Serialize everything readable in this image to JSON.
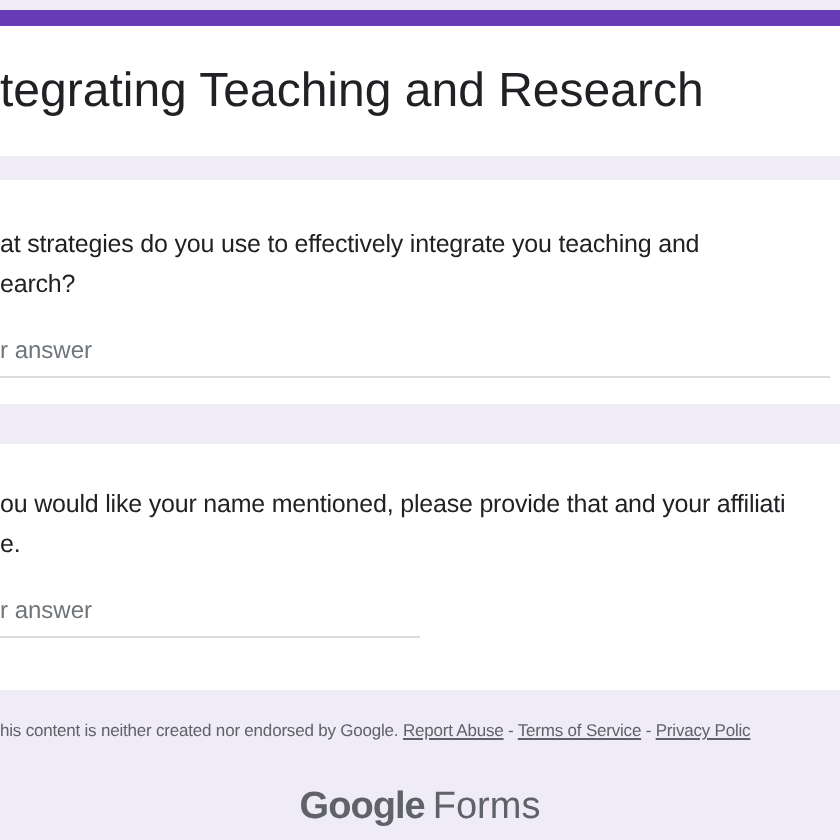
{
  "form": {
    "title": "tegrating Teaching and Research"
  },
  "questions": [
    {
      "lines": [
        "at strategies do you use to effectively integrate you teaching and",
        "earch?"
      ],
      "placeholder": "r answer",
      "kind": "paragraph"
    },
    {
      "lines": [
        "ou would like your name mentioned, please provide that and your affiliati",
        "e."
      ],
      "placeholder": "r answer",
      "kind": "short"
    }
  ],
  "footer": {
    "notice": "his content is neither created nor endorsed by Google.",
    "links": [
      "Report Abuse",
      "Terms of Service",
      "Privacy Polic"
    ],
    "separator": "-",
    "brand": {
      "logo": "Google",
      "product": "Forms"
    }
  }
}
